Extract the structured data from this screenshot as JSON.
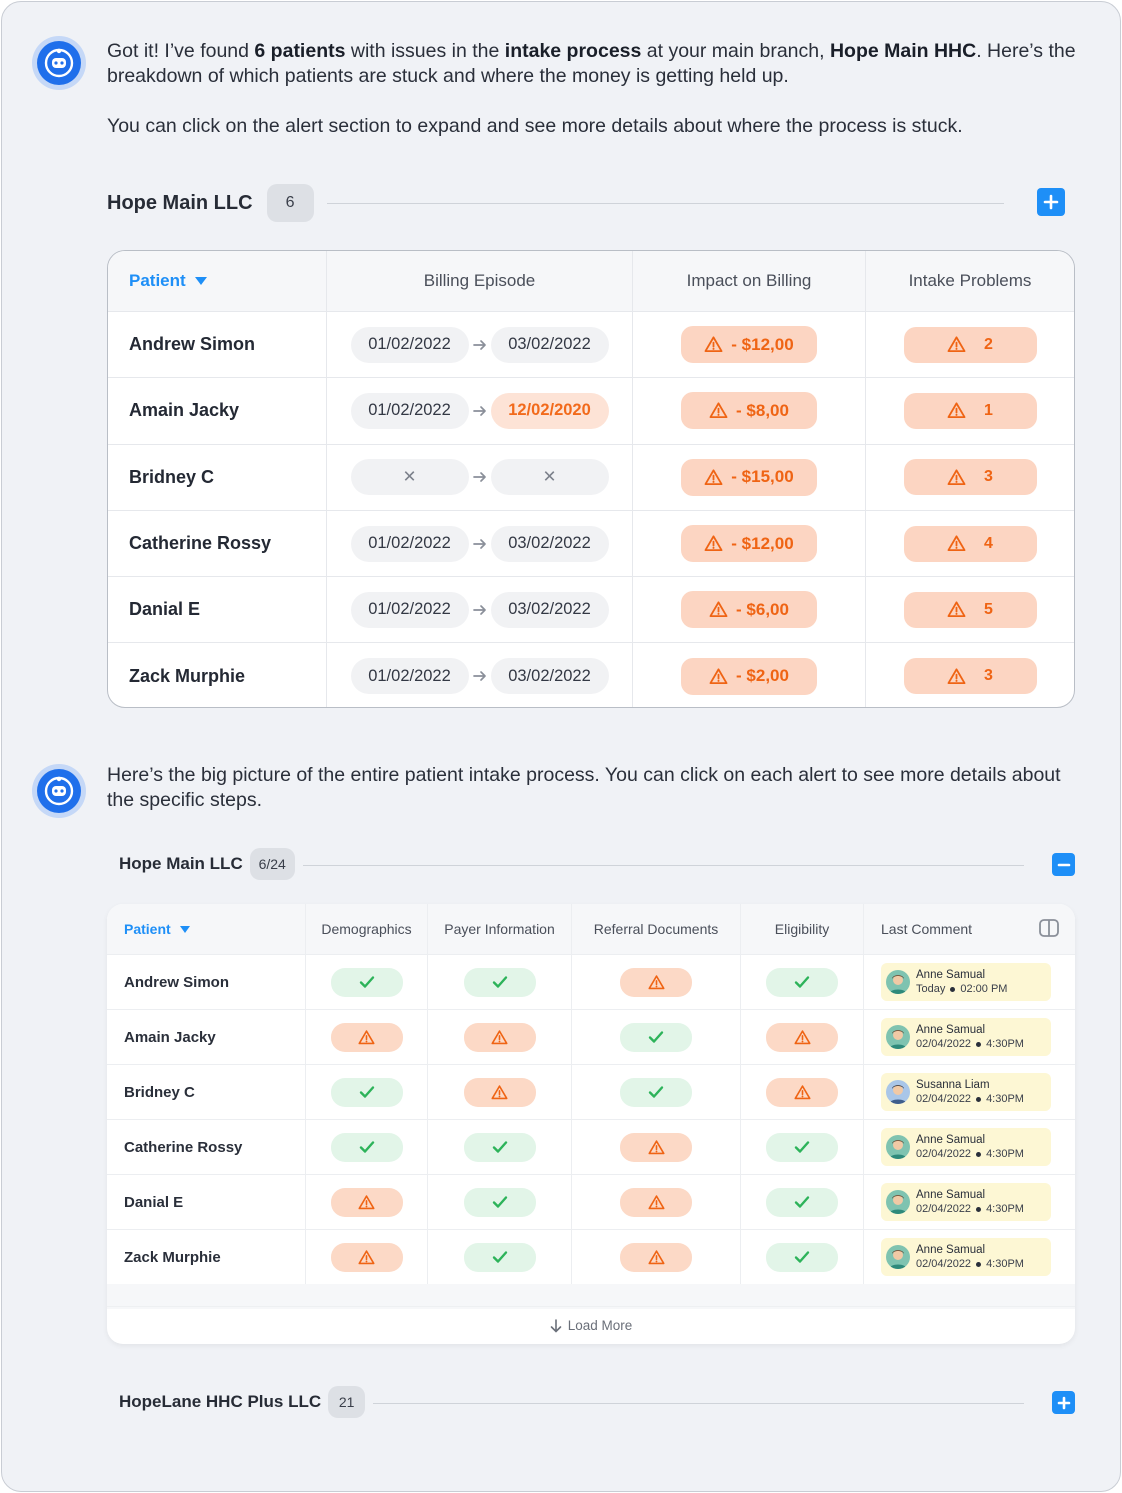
{
  "message1": {
    "p1": [
      "Got it! I’ve found ",
      "6 patients",
      " with issues in the ",
      "intake process",
      " at your main branch, ",
      "Hope Main HHC",
      ". Here’s the breakdown of which patients are stuck and where the money is getting held up."
    ],
    "p2": "You can click on the alert section to expand and see more details about where the process is stuck."
  },
  "group1": {
    "title": "Hope Main LLC",
    "count": "6"
  },
  "table1": {
    "headers": {
      "patient": "Patient",
      "billing": "Billing Episode",
      "impact": "Impact on Billing",
      "problems": "Intake Problems"
    },
    "rows": [
      {
        "name": "Andrew Simon",
        "start": "01/02/2022",
        "end": "03/02/2022",
        "impact": "- $12,00",
        "problems": "2"
      },
      {
        "name": "Amain Jacky",
        "start": "01/02/2022",
        "end": "12/02/2020",
        "impact": "- $8,00",
        "problems": "1"
      },
      {
        "name": "Bridney C",
        "start": "✕",
        "end": "✕",
        "impact": "- $15,00",
        "problems": "3"
      },
      {
        "name": "Catherine Rossy",
        "start": "01/02/2022",
        "end": "03/02/2022",
        "impact": "- $12,00",
        "problems": "4"
      },
      {
        "name": "Danial E",
        "start": "01/02/2022",
        "end": "03/02/2022",
        "impact": "- $6,00",
        "problems": "5"
      },
      {
        "name": "Zack Murphie",
        "start": "01/02/2022",
        "end": "03/02/2022",
        "impact": "- $2,00",
        "problems": "3"
      }
    ]
  },
  "message2": {
    "text": "Here’s the big picture of the entire patient intake process. You can click on each alert to see more details about the specific steps."
  },
  "group2": {
    "title": "Hope Main LLC",
    "count": "6/24"
  },
  "table2": {
    "headers": {
      "patient": "Patient",
      "demographics": "Demographics",
      "payer": "Payer Information",
      "referral": "Referral Documents",
      "eligibility": "Eligibility",
      "comment": "Last Comment"
    },
    "rows": [
      {
        "name": "Andrew Simon",
        "demographics": "ok",
        "payer": "ok",
        "referral": "warn",
        "eligibility": "ok",
        "commenter": "Anne Samual",
        "date": "Today",
        "time": "02:00 PM"
      },
      {
        "name": "Amain Jacky",
        "demographics": "warn",
        "payer": "warn",
        "referral": "ok",
        "eligibility": "warn",
        "commenter": "Anne Samual",
        "date": "02/04/2022",
        "time": "4:30PM"
      },
      {
        "name": "Bridney C",
        "demographics": "ok",
        "payer": "warn",
        "referral": "ok",
        "eligibility": "warn",
        "commenter": "Susanna Liam",
        "date": "02/04/2022",
        "time": "4:30PM"
      },
      {
        "name": "Catherine Rossy",
        "demographics": "ok",
        "payer": "ok",
        "referral": "warn",
        "eligibility": "ok",
        "commenter": "Anne Samual",
        "date": "02/04/2022",
        "time": "4:30PM"
      },
      {
        "name": "Danial E",
        "demographics": "warn",
        "payer": "ok",
        "referral": "warn",
        "eligibility": "ok",
        "commenter": "Anne Samual",
        "date": "02/04/2022",
        "time": "4:30PM"
      },
      {
        "name": "Zack Murphie",
        "demographics": "warn",
        "payer": "ok",
        "referral": "warn",
        "eligibility": "ok",
        "commenter": "Anne Samual",
        "date": "02/04/2022",
        "time": "4:30PM"
      }
    ],
    "load_more": "Load More"
  },
  "group3": {
    "title": "HopeLane HHC Plus LLC",
    "count": "21"
  },
  "colors": {
    "accent": "#1e8ff7",
    "alert": "#ef6414",
    "alert_bg": "#fcd5c2",
    "ok": "#2db35a",
    "ok_bg": "#e2f5e8"
  },
  "icons": {
    "bot": "robot-icon",
    "add": "plus-icon",
    "collapse": "minus-icon",
    "warn": "warning-icon",
    "ok": "check-icon",
    "sort": "caret-down-icon",
    "columns": "columns-icon",
    "load": "arrow-down-icon"
  }
}
